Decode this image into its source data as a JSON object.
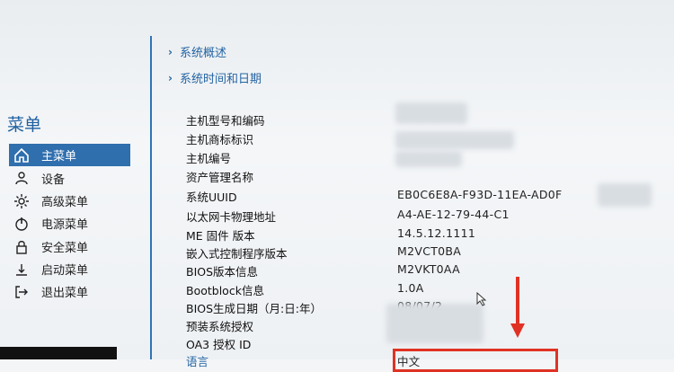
{
  "sidebar": {
    "title": "菜单",
    "items": [
      {
        "label": "主菜单",
        "icon": "home-icon",
        "active": true
      },
      {
        "label": "设备",
        "icon": "devices-icon",
        "active": false
      },
      {
        "label": "高级菜单",
        "icon": "gear-icon",
        "active": false
      },
      {
        "label": "电源菜单",
        "icon": "power-icon",
        "active": false
      },
      {
        "label": "安全菜单",
        "icon": "lock-icon",
        "active": false
      },
      {
        "label": "启动菜单",
        "icon": "boot-icon",
        "active": false
      },
      {
        "label": "退出菜单",
        "icon": "exit-icon",
        "active": false
      }
    ]
  },
  "main": {
    "links": [
      {
        "label": "系统概述"
      },
      {
        "label": "系统时间和日期"
      }
    ],
    "rows": [
      {
        "label": "主机型号和编码",
        "value": ""
      },
      {
        "label": "主机商标标识",
        "value": ""
      },
      {
        "label": "主机编号",
        "value": ""
      },
      {
        "label": "资产管理名称",
        "value": ""
      },
      {
        "label": "系统UUID",
        "value": "EB0C6E8A-F93D-11EA-AD0F"
      },
      {
        "label": "以太网卡物理地址",
        "value": "A4-AE-12-79-44-C1"
      },
      {
        "label": "ME 固件 版本",
        "value": "14.5.12.1111"
      },
      {
        "label": "嵌入式控制程序版本",
        "value": "M2VCT0BA"
      },
      {
        "label": "BIOS版本信息",
        "value": "M2VKT0AA"
      },
      {
        "label": "Bootblock信息",
        "value": "1.0A"
      },
      {
        "label": "BIOS生成日期（月:日:年）",
        "value": "08/07/2"
      },
      {
        "label": "预装系统授权",
        "value": ""
      },
      {
        "label": "OA3 授权 ID",
        "value": ""
      },
      {
        "label": "语言",
        "value": "中文"
      }
    ]
  },
  "colors": {
    "accent": "#2f6fae",
    "link": "#2464a3",
    "annotation": "#e03224"
  }
}
